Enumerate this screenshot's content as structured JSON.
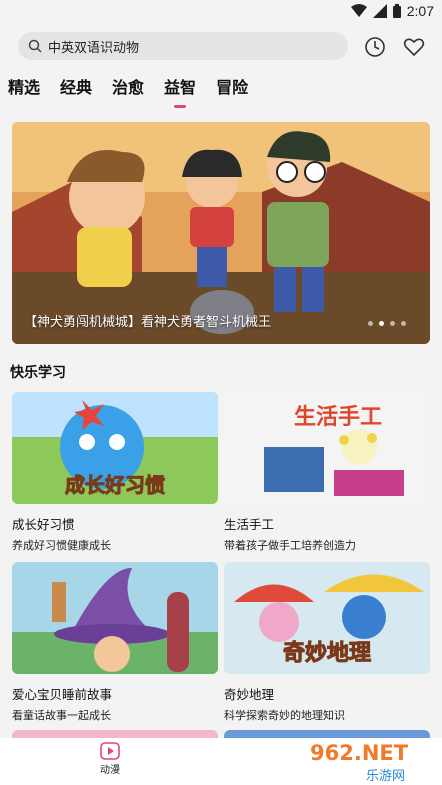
{
  "status": {
    "time": "2:07"
  },
  "search": {
    "text": "中英双语识动物"
  },
  "tabs": [
    {
      "label": "精选"
    },
    {
      "label": "经典"
    },
    {
      "label": "治愈"
    },
    {
      "label": "益智",
      "active": true
    },
    {
      "label": "冒险"
    }
  ],
  "banner": {
    "caption": "【神犬勇闯机械城】看神犬勇者智斗机械王"
  },
  "section": {
    "title": "快乐学习"
  },
  "cards": [
    {
      "title": "成长好习惯",
      "subtitle": "养成好习惯健康成长",
      "thumb_text": "成长好习惯"
    },
    {
      "title": "生活手工",
      "subtitle": "带着孩子做手工培养创造力",
      "thumb_text": "生活手工"
    },
    {
      "title": "爱心宝贝睡前故事",
      "subtitle": "看童话故事一起成长"
    },
    {
      "title": "奇妙地理",
      "subtitle": "科学探索奇妙的地理知识",
      "thumb_text": "奇妙地理"
    }
  ],
  "bottom_nav": {
    "label": "动漫"
  },
  "watermark": {
    "text": "962.NET",
    "subtext": "乐游网"
  },
  "colors": {
    "accent": "#e0457b",
    "background": "#f3f3f3"
  }
}
